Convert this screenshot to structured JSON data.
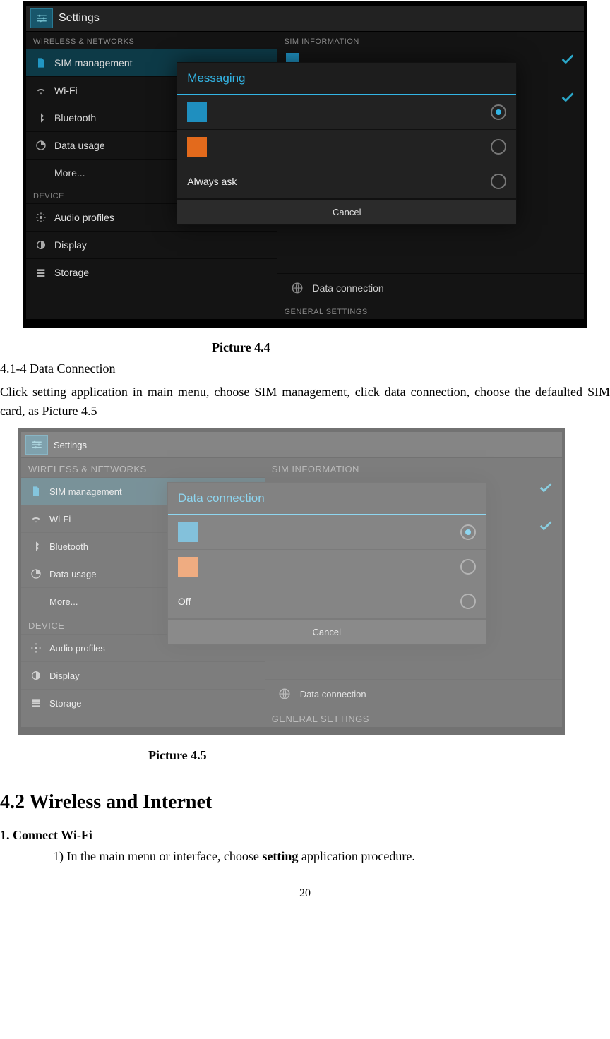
{
  "captions": {
    "pic44": "Picture 4.4",
    "pic45": "Picture 4.5"
  },
  "text": {
    "sec414_title": "4.1-4 Data Connection",
    "sec414_body": "Click setting application in main menu, choose SIM management, click data connection, choose the defaulted SIM card, as Picture 4.5",
    "sec42_heading": "4.2 Wireless and Internet",
    "connect_wifi": "1. Connect Wi-Fi",
    "step1_a": "1) In the main menu or interface, choose ",
    "step1_b": "setting",
    "step1_c": " application procedure.",
    "pagenum": "20"
  },
  "shot_common": {
    "settings": "Settings",
    "wireless_header": "WIRELESS & NETWORKS",
    "device_header": "DEVICE",
    "sim_management": "SIM management",
    "wifi": "Wi-Fi",
    "bluetooth": "Bluetooth",
    "data_usage": "Data usage",
    "more": "More...",
    "audio_profiles": "Audio profiles",
    "display": "Display",
    "storage": "Storage",
    "sim_information": "SIM INFORMATION",
    "general_settings": "GENERAL SETTINGS",
    "data_connection": "Data connection",
    "cancel": "Cancel"
  },
  "shot1": {
    "dialog_title": "Messaging",
    "opt3_label": "Always ask"
  },
  "shot2": {
    "dialog_title": "Data connection",
    "opt3_label": "Off"
  }
}
